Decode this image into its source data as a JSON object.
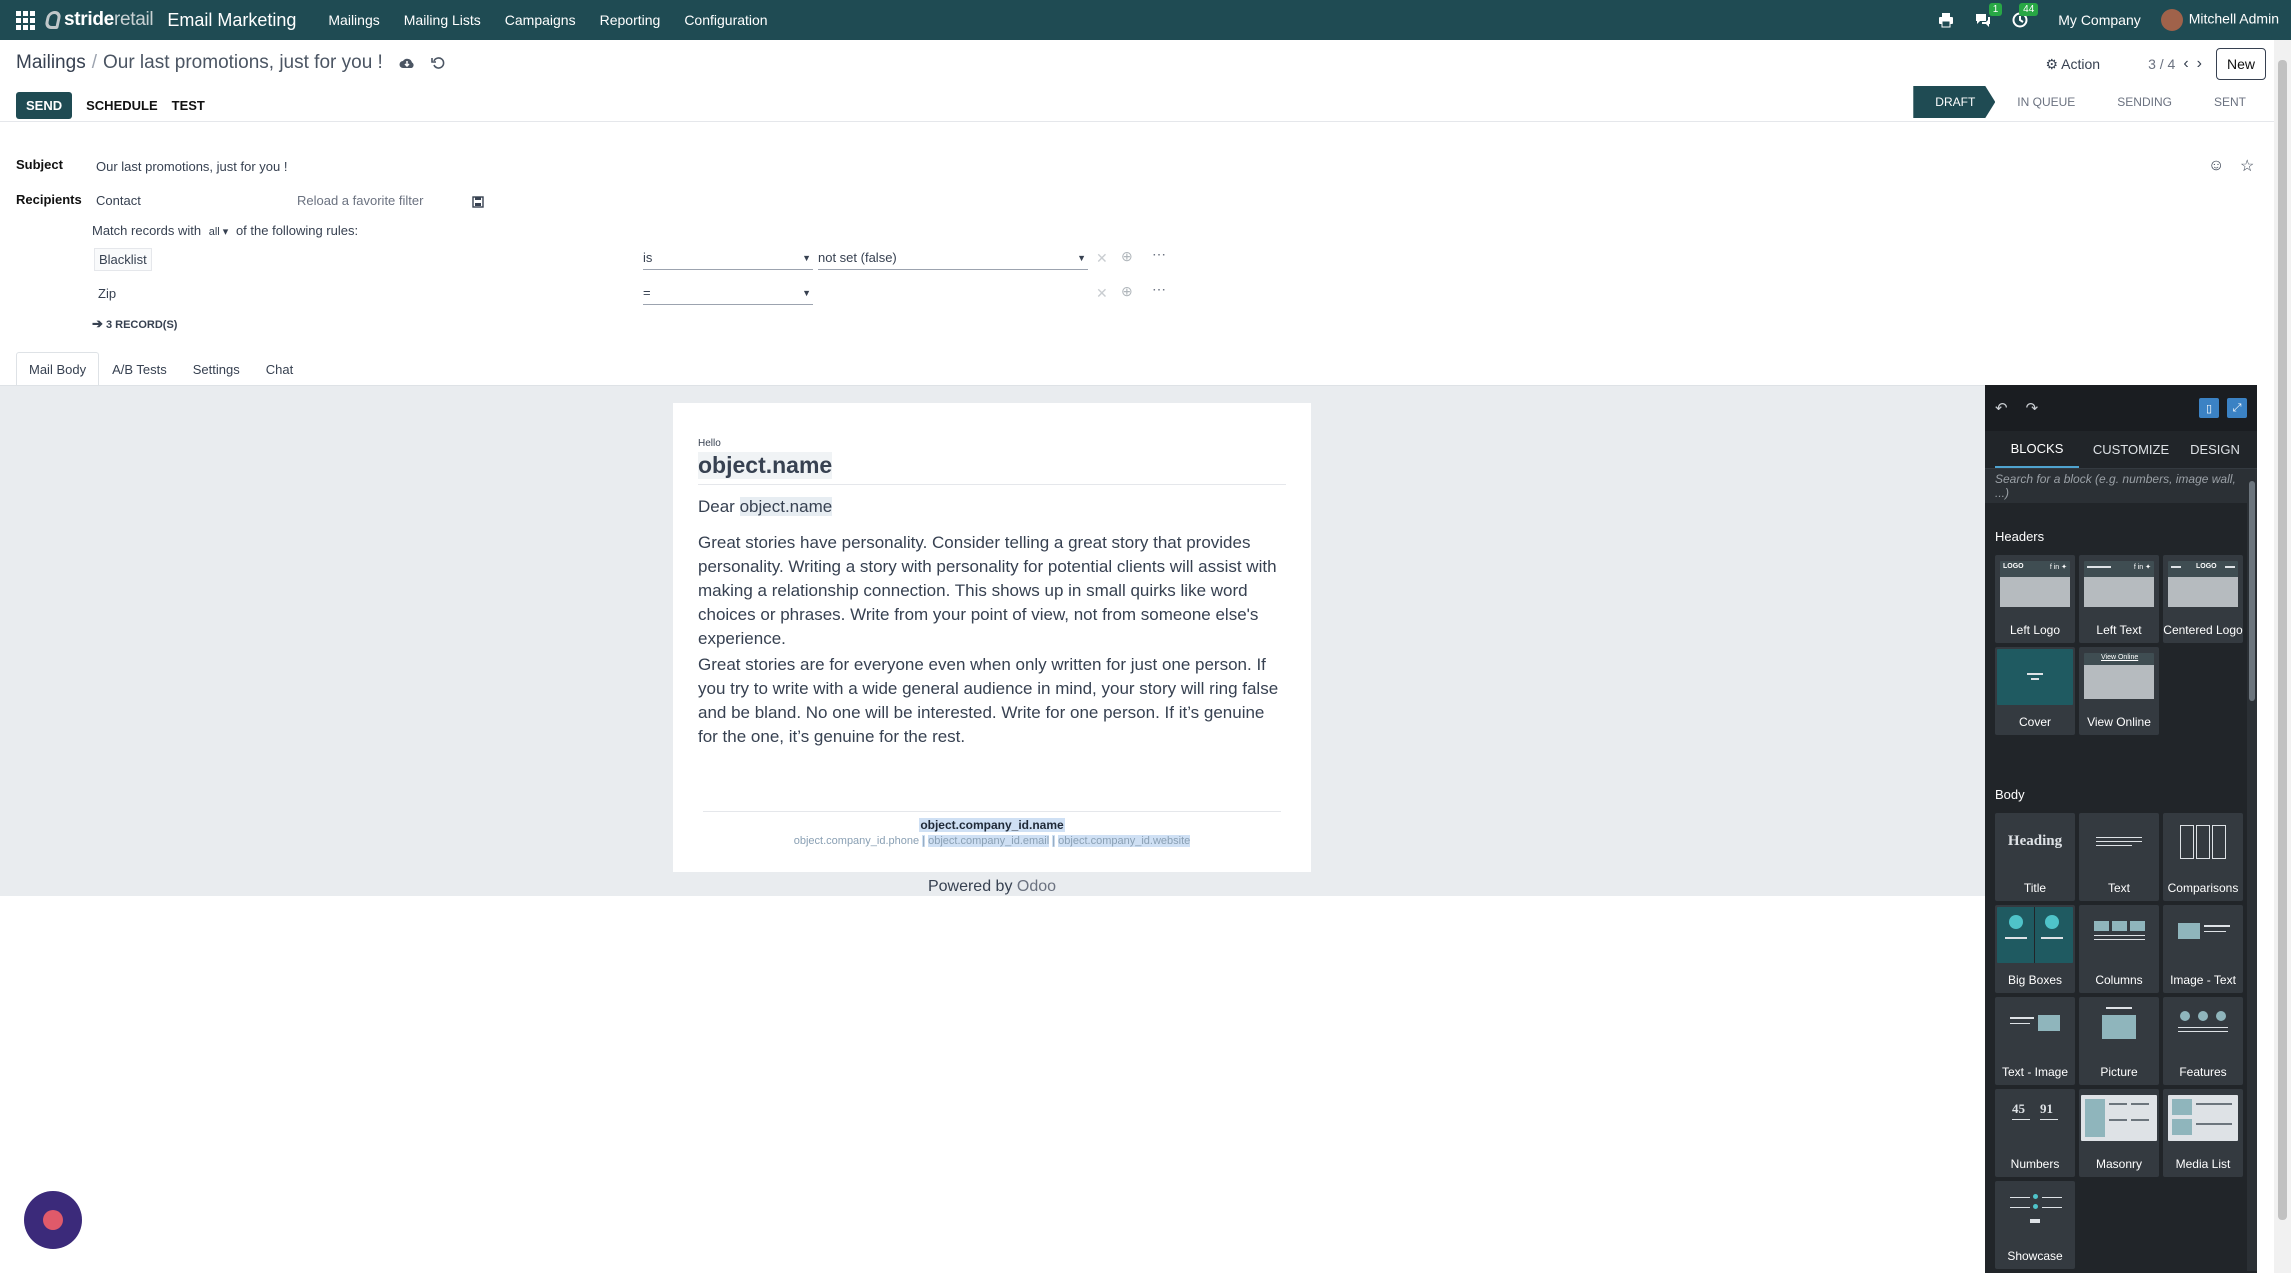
{
  "topnav": {
    "brand_bold": "stride",
    "brand_light": "retail",
    "app_name": "Email Marketing",
    "menus": [
      "Mailings",
      "Mailing Lists",
      "Campaigns",
      "Reporting",
      "Configuration"
    ],
    "messages_badge": "1",
    "activities_badge": "44",
    "company": "My Company",
    "user": "Mitchell Admin"
  },
  "breadcrumb": {
    "root": "Mailings",
    "separator": "/",
    "current": "Our last promotions, just for you !"
  },
  "control": {
    "action_label": "Action",
    "pager": "3 / 4",
    "new_label": "New"
  },
  "actions": {
    "send": "SEND",
    "schedule": "SCHEDULE",
    "test": "TEST"
  },
  "status": {
    "steps": [
      "DRAFT",
      "IN QUEUE",
      "SENDING",
      "SENT"
    ],
    "active": "DRAFT"
  },
  "form": {
    "subject_label": "Subject",
    "subject_value": "Our last promotions, just for you !",
    "recipients_label": "Recipients",
    "recipients_model": "Contact",
    "reload_filter": "Reload a favorite filter",
    "match_prefix": "Match records with",
    "match_mode": "all",
    "match_suffix": "of the following rules:",
    "rules": [
      {
        "field": "Blacklist",
        "operator": "is",
        "value": "not set (false)"
      },
      {
        "field": "Zip",
        "operator": "=",
        "value": ""
      }
    ],
    "records": "3 RECORD(S)"
  },
  "tabs": [
    "Mail Body",
    "A/B Tests",
    "Settings",
    "Chat"
  ],
  "mail": {
    "hello": "Hello",
    "heading": "object.name",
    "dear": "Dear",
    "dear_name": "object.name",
    "para1": "Great stories have personality. Consider telling a great story that provides personality. Writing a story with personality for potential clients will assist with making a relationship connection. This shows up in small quirks like word choices or phrases. Write from your point of view, not from someone else's experience.",
    "para2": "Great stories are for everyone even when only written for just one person. If you try to write with a wide general audience in mind, your story will ring false and be bland. No one will be interested. Write for one person. If it’s genuine for the one, it’s genuine for the rest.",
    "footer_name": "object.company_id.name",
    "footer_phone": "object.company_id.phone",
    "footer_email": "object.company_id.email",
    "footer_website": "object.company_id.website",
    "footer_sep": "|",
    "powered_prefix": "Powered by",
    "powered_brand": "Odoo"
  },
  "sidebar": {
    "tabs": [
      "BLOCKS",
      "CUSTOMIZE",
      "DESIGN"
    ],
    "search_placeholder": "Search for a block (e.g. numbers, image wall, ...)",
    "headers_label": "Headers",
    "headers": [
      "Left Logo",
      "Left Text",
      "Centered Logo",
      "Cover",
      "View Online"
    ],
    "body_label": "Body",
    "body": [
      "Title",
      "Text",
      "Comparisons",
      "Big Boxes",
      "Columns",
      "Image - Text",
      "Text - Image",
      "Picture",
      "Features",
      "Numbers",
      "Masonry",
      "Media List",
      "Showcase"
    ],
    "thumb_logo": "LOGO",
    "thumb_social": "f in ✦",
    "thumb_view_online": "View Online",
    "thumb_heading": "Heading",
    "thumb_num1": "45",
    "thumb_num2": "91"
  },
  "colors": {
    "brand": "#1f4b53",
    "sidebar_bg": "#212529",
    "accent": "#4fa3cf"
  }
}
